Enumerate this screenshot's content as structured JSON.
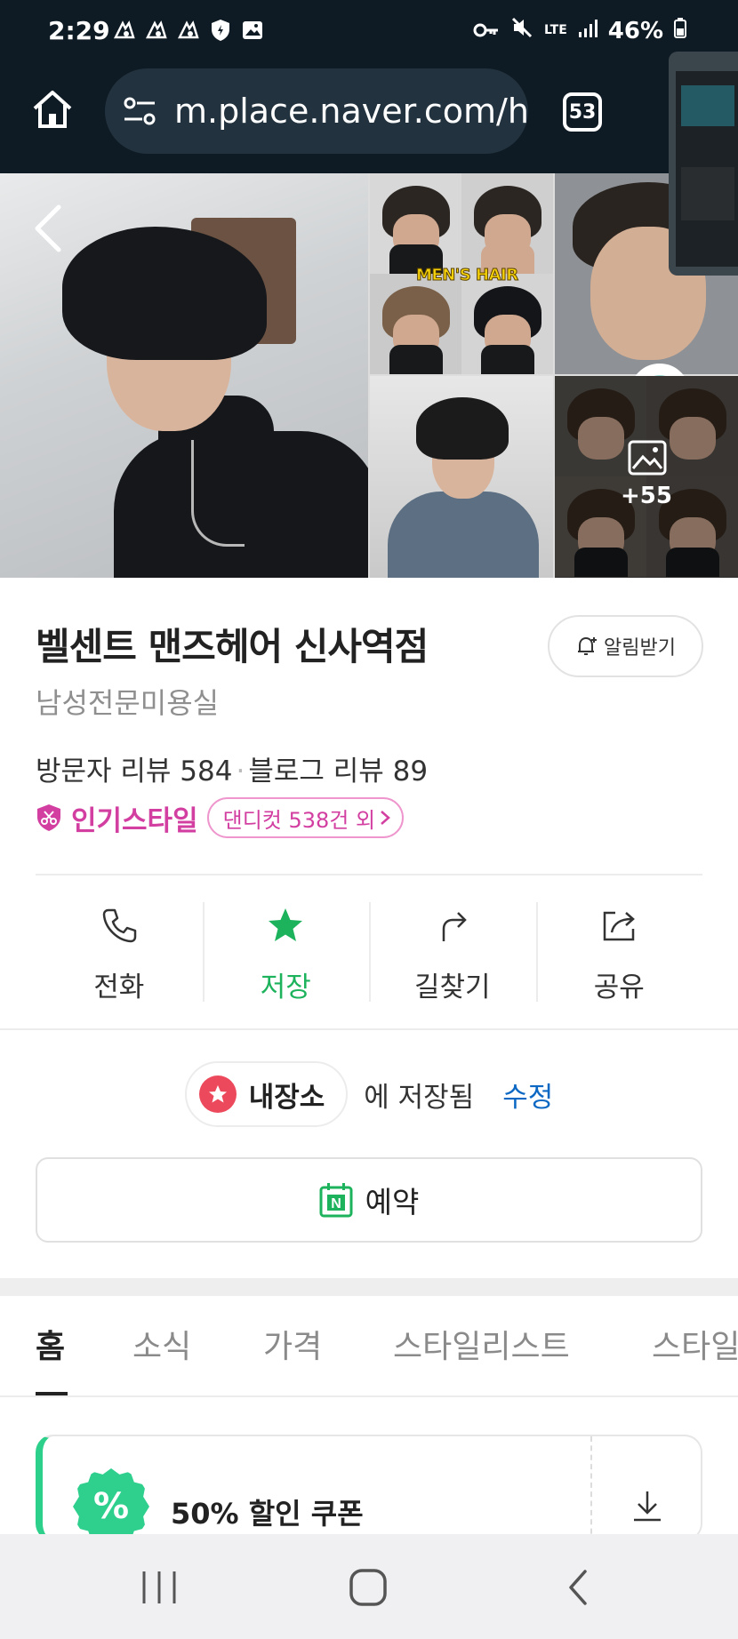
{
  "status_bar": {
    "time": "2:29",
    "network": "LTE",
    "battery": "46%",
    "icons": [
      "notification-icon",
      "notification-icon",
      "notification-icon",
      "shield-icon",
      "image-icon",
      "key-icon",
      "mute-icon",
      "signal-icon",
      "battery-icon"
    ]
  },
  "browser": {
    "url": "m.place.naver.com/h",
    "tab_count": "53"
  },
  "gallery": {
    "photo_badge": "MEN'S HAIR",
    "more_count": "+55"
  },
  "place": {
    "title": "벨센트 맨즈헤어 신사역점",
    "category": "남성전문미용실",
    "alarm_label": "알림받기",
    "visitor_reviews": "방문자 리뷰 584",
    "blog_reviews": "블로그 리뷰 89",
    "popular_label": "인기스타일",
    "popular_chip": "댄디컷 538건 외"
  },
  "actions": [
    {
      "label": "전화",
      "icon": "phone-icon"
    },
    {
      "label": "저장",
      "icon": "star-icon"
    },
    {
      "label": "길찾기",
      "icon": "directions-icon"
    },
    {
      "label": "공유",
      "icon": "share-icon"
    }
  ],
  "saved": {
    "list_name": "내장소",
    "saved_text": "에 저장됨",
    "edit_label": "수정"
  },
  "reserve": {
    "label": "예약",
    "icon_letter": "N"
  },
  "tabs": [
    "홈",
    "소식",
    "가격",
    "스타일리스트",
    "스타일"
  ],
  "coupon": {
    "title": "50% 할인 쿠폰",
    "icon_text": "%"
  },
  "colors": {
    "accent_green": "#1db25c",
    "pink": "#d23fa1",
    "link_blue": "#0d68c4",
    "saved_red": "#ec4a5c",
    "browser_dark": "#0f1b24"
  }
}
